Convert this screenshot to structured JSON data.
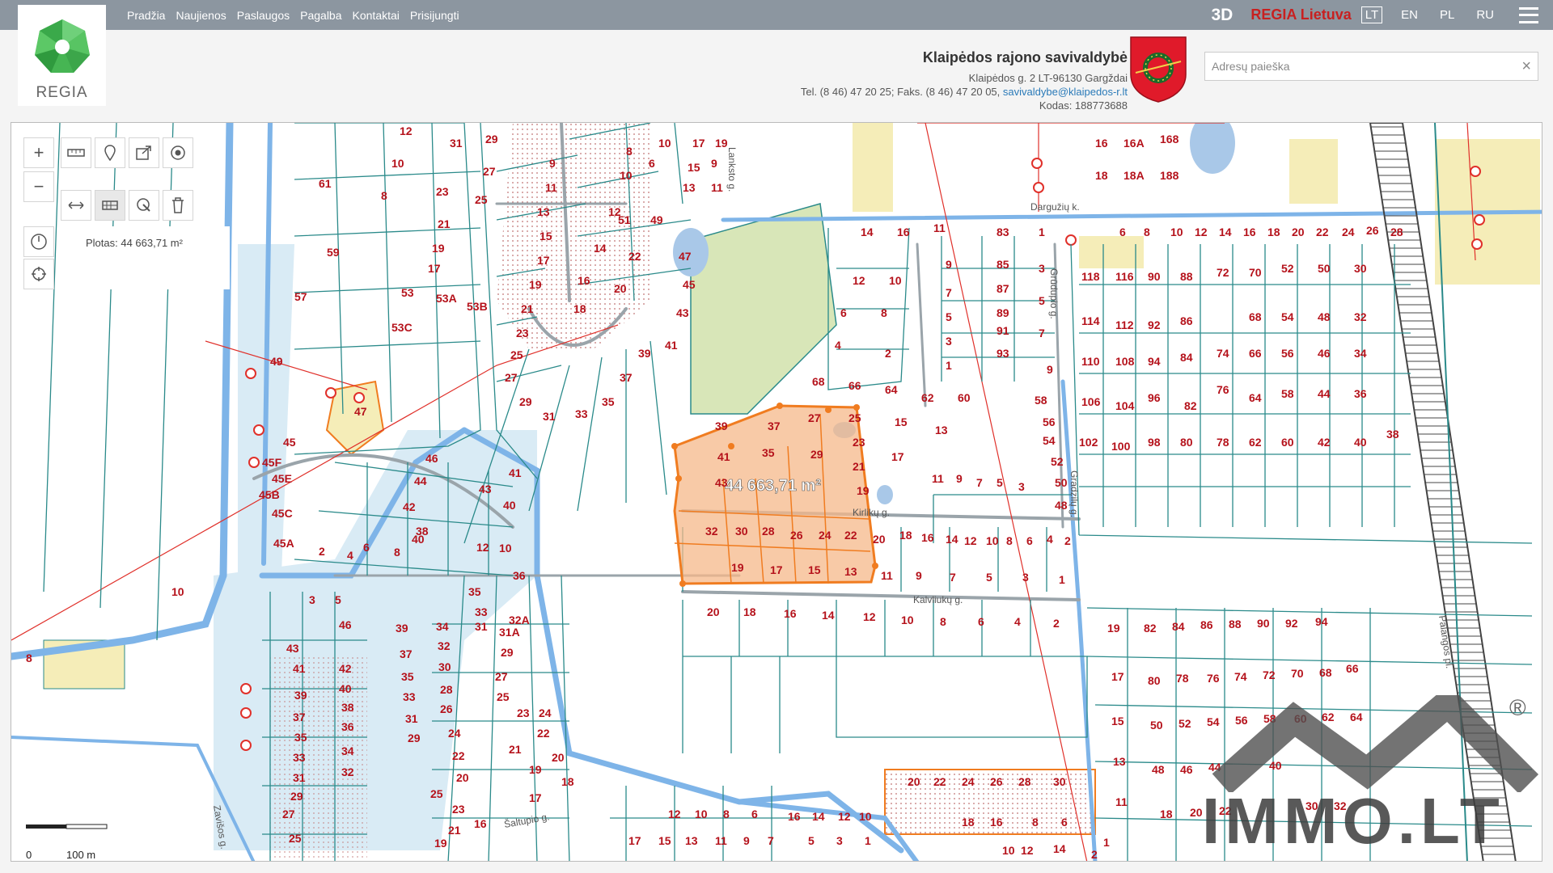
{
  "nav": {
    "links": [
      "Pradžia",
      "Naujienos",
      "Paslaugos",
      "Pagalba",
      "Kontaktai",
      "Prisijungti"
    ],
    "btn_3d": "3D",
    "brand": "REGIA Lietuva",
    "languages": [
      "LT",
      "EN",
      "PL",
      "RU"
    ],
    "active_language": "LT"
  },
  "logo": {
    "text": "REGIA"
  },
  "municipality": {
    "name": "Klaipėdos rajono savivaldybė",
    "address": "Klaipėdos g. 2 LT-96130 Gargždai",
    "contact_prefix": "Tel. (8 46) 47 20 25; Faks. (8 46) 47 20 05, ",
    "email": "savivaldybe@klaipedos-r.lt",
    "code": "Kodas: 188773688"
  },
  "search": {
    "placeholder": "Adresų paieška",
    "value": "",
    "clear": "×"
  },
  "tools": {
    "zoom_in": "+",
    "zoom_out": "−",
    "area_text": "Plotas: 44 663,71 m²"
  },
  "map": {
    "measure_label": "44 663,71 m²",
    "streets": [
      "Kirlikų g.",
      "Kalvliukų g.",
      "Šaltupio g.",
      "Grūdupio g.",
      "Dargužių k.",
      "Palangos pl.",
      "Lanksto g.",
      "Gradzilų g.",
      "Zavišos g."
    ],
    "scale": {
      "zero": "0",
      "distance": "100 m"
    }
  },
  "watermark": {
    "text": "IMMO.LT",
    "reg": "®"
  },
  "colors": {
    "topbar": "#8c96a0",
    "parcel_line": "#2a8a8a",
    "parcel_number": "#b5121b",
    "selection": "#f07c20",
    "selection_fill": "#f6b889",
    "water": "#a9c8e8",
    "green": "#d8e6b8",
    "built": "#f5edb8"
  }
}
